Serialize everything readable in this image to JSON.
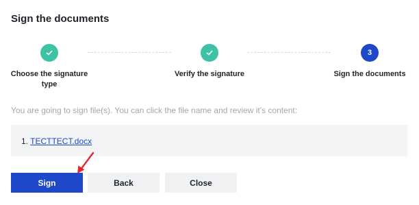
{
  "header": {
    "title": "Sign the documents"
  },
  "stepper": {
    "steps": [
      {
        "label": "Choose the signature type",
        "status": "done",
        "icon": "check-icon"
      },
      {
        "label": "Verify the signature",
        "status": "done",
        "icon": "check-icon"
      },
      {
        "label": "Sign the documents",
        "status": "current",
        "number": "3"
      }
    ]
  },
  "info_text": "You are going to sign file(s). You can click the file name and review it's content:",
  "files": [
    {
      "index": "1.",
      "name": "TECTTECT.docx"
    }
  ],
  "buttons": {
    "sign": "Sign",
    "back": "Back",
    "close": "Close"
  },
  "colors": {
    "primary": "#1e47c9",
    "done": "#3fc1a5",
    "annotation_arrow": "#e3262b"
  }
}
